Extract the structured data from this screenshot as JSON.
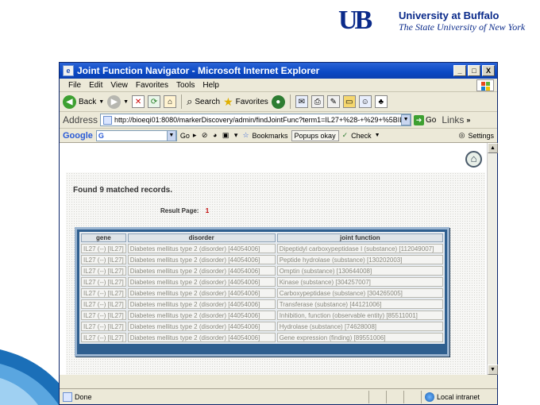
{
  "slide": {
    "logo_mark": "UB",
    "university_name": "University at Buffalo",
    "university_subtitle": "The State University of New York"
  },
  "window": {
    "title": "Joint Function Navigator - Microsoft Internet Explorer",
    "controls": {
      "minimize": "_",
      "maximize": "□",
      "close": "X"
    }
  },
  "menu": [
    "File",
    "Edit",
    "View",
    "Favorites",
    "Tools",
    "Help"
  ],
  "toolbar": {
    "back": "Back",
    "search": "Search",
    "favorites": "Favorites"
  },
  "address": {
    "label": "Address",
    "url": "http://bioeqi01:8080/markerDiscovery/admin/findJointFunc?term1=IL27+%28-+%29+%5BIL27",
    "go": "Go",
    "links": "Links"
  },
  "google_toolbar": {
    "logo": "Google",
    "input_prefix": "G",
    "go": "Go",
    "bookmarks": "Bookmarks",
    "popups": "Popups okay",
    "check": "Check",
    "settings": "Settings"
  },
  "page": {
    "found_text": "Found 9 matched records.",
    "result_page_label": "Result Page:",
    "result_page_number": "1",
    "table": {
      "headers": [
        "gene",
        "disorder",
        "joint function"
      ],
      "rows": [
        [
          "IL27 (--) [IL27]",
          "Diabetes mellitus type 2 (disorder) [44054006]",
          "Dipeptidyl carboxypeptidase I (substance) [112049007]"
        ],
        [
          "IL27 (--) [IL27]",
          "Diabetes mellitus type 2 (disorder) [44054006]",
          "Peptide hydrolase (substance) [130202003]"
        ],
        [
          "IL27 (--) [IL27]",
          "Diabetes mellitus type 2 (disorder) [44054006]",
          "Omptin (substance) [130644008]"
        ],
        [
          "IL27 (--) [IL27]",
          "Diabetes mellitus type 2 (disorder) [44054006]",
          "Kinase (substance) [304257007]"
        ],
        [
          "IL27 (--) [IL27]",
          "Diabetes mellitus type 2 (disorder) [44054006]",
          "Carboxypeptidase (substance) [304265005]"
        ],
        [
          "IL27 (--) [IL27]",
          "Diabetes mellitus type 2 (disorder) [44054006]",
          "Transferase (substance) [44121006]"
        ],
        [
          "IL27 (--) [IL27]",
          "Diabetes mellitus type 2 (disorder) [44054006]",
          "Inhibition, function (observable entity) [85511001]"
        ],
        [
          "IL27 (--) [IL27]",
          "Diabetes mellitus type 2 (disorder) [44054006]",
          "Hydrolase (substance) [74628008]"
        ],
        [
          "IL27 (--) [IL27]",
          "Diabetes mellitus type 2 (disorder) [44054006]",
          "Gene expression (finding) [89551006]"
        ]
      ]
    }
  },
  "status": {
    "text": "Done",
    "zone": "Local intranet"
  },
  "colors": {
    "ub_blue": "#0a2a8a",
    "titlebar_blue": "#0a48c4",
    "table_frame": "#2f5f8f",
    "page_number_red": "#c00000"
  }
}
